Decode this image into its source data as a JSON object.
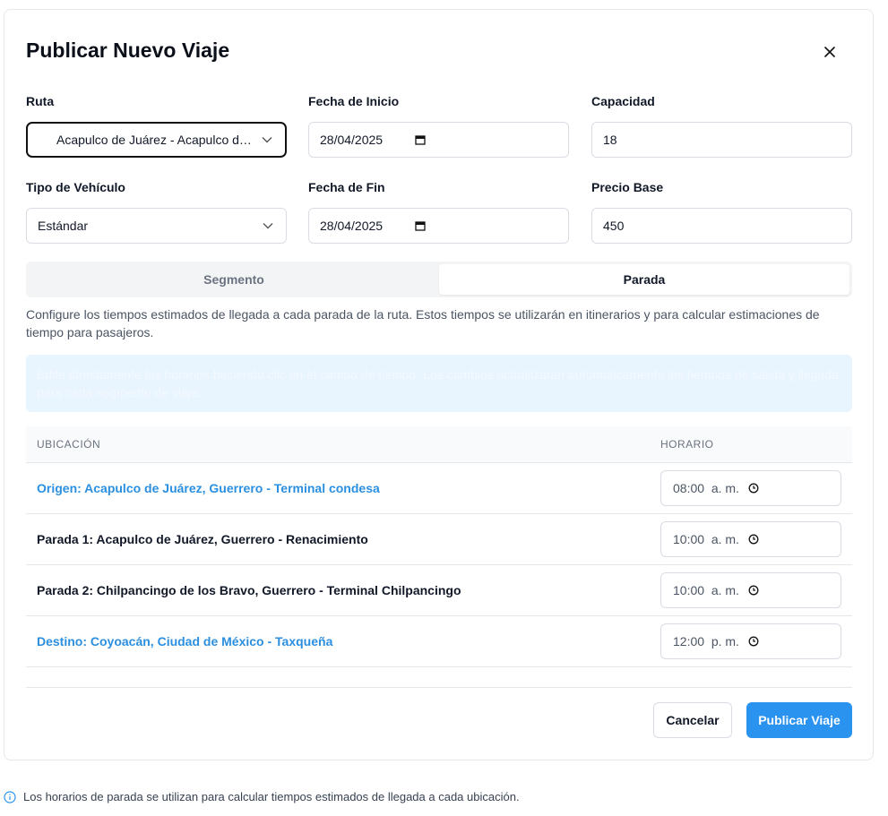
{
  "dialog": {
    "title": "Publicar Nuevo Viaje",
    "close_icon": "close-icon"
  },
  "form": {
    "ruta": {
      "label": "Ruta",
      "value": "Acapulco de Juárez - Acapulco de..."
    },
    "fecha_inicio": {
      "label": "Fecha de Inicio",
      "value": "28/04/2025"
    },
    "capacidad": {
      "label": "Capacidad",
      "value": "18"
    },
    "tipo_vehiculo": {
      "label": "Tipo de Vehículo",
      "value": "Estándar"
    },
    "fecha_fin": {
      "label": "Fecha de Fin",
      "value": "28/04/2025"
    },
    "precio_base": {
      "label": "Precio Base",
      "value": "450"
    }
  },
  "tabs": [
    {
      "label": "Segmento",
      "active": false
    },
    {
      "label": "Parada",
      "active": true
    }
  ],
  "description": "Configure los tiempos estimados de llegada a cada parada de la ruta. Estos tiempos se utilizarán en itinerarios y para calcular estimaciones de tiempo para pasajeros.",
  "info_box": "Edite directamente los horarios haciendo clic en el campo de tiempo. Los cambios actualizarán automáticamente los tiempos de salida y llegada para cada segmento de viaje.",
  "table": {
    "headers": {
      "location": "UBICACIÓN",
      "schedule": "HORARIO"
    },
    "rows": [
      {
        "location": "Origen: Acapulco de Juárez, Guerrero - Terminal condesa",
        "time": "08:00  a. m.",
        "highlight": true
      },
      {
        "location": "Parada 1: Acapulco de Juárez, Guerrero - Renacimiento",
        "time": "10:00  a. m.",
        "highlight": false
      },
      {
        "location": "Parada 2: Chilpancingo de los Bravo, Guerrero - Terminal Chilpancingo",
        "time": "10:00  a. m.",
        "highlight": false
      },
      {
        "location": "Destino: Coyoacán, Ciudad de México - Taxqueña",
        "time": "12:00  p. m.",
        "highlight": true
      }
    ]
  },
  "buttons": {
    "cancel": "Cancelar",
    "publish": "Publicar Viaje"
  },
  "note": "Los horarios de parada se utilizan para calcular tiempos estimados de llegada a cada ubicación.",
  "colors": {
    "accent": "#2a93ef",
    "link": "#2b8fe0",
    "info_bg": "#e8f4fe"
  }
}
